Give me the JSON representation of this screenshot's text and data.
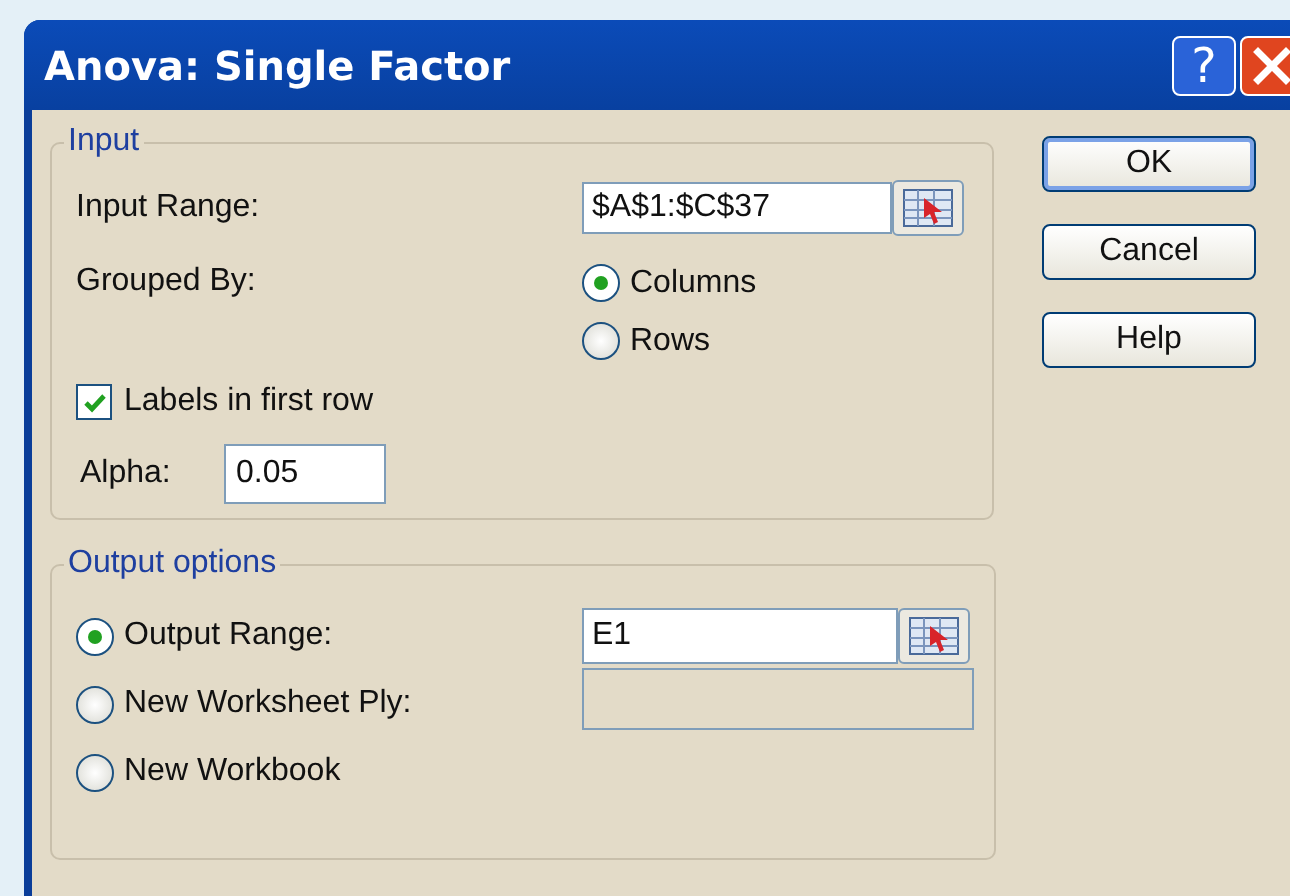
{
  "window": {
    "title": "Anova: Single Factor",
    "help_button": "?"
  },
  "input": {
    "legend": "Input",
    "input_range": {
      "label": "Input Range:",
      "value": "$A$1:$C$37"
    },
    "grouped_by": {
      "label": "Grouped By:",
      "options": [
        {
          "label": "Columns",
          "selected": true
        },
        {
          "label": "Rows",
          "selected": false
        }
      ]
    },
    "labels_in_first_row": {
      "label": "Labels in first row",
      "checked": true
    },
    "alpha": {
      "label": "Alpha:",
      "value": "0.05"
    }
  },
  "output": {
    "legend": "Output options",
    "options": [
      {
        "kind": "range",
        "label": "Output Range:",
        "selected": true,
        "value": "E1"
      },
      {
        "kind": "ply",
        "label": "New Worksheet Ply:",
        "selected": false
      },
      {
        "kind": "plain",
        "label": "New Workbook",
        "selected": false
      }
    ]
  },
  "buttons": [
    {
      "label": "OK",
      "default": true
    },
    {
      "label": "Cancel",
      "default": false
    },
    {
      "label": "Help",
      "default": false
    }
  ]
}
